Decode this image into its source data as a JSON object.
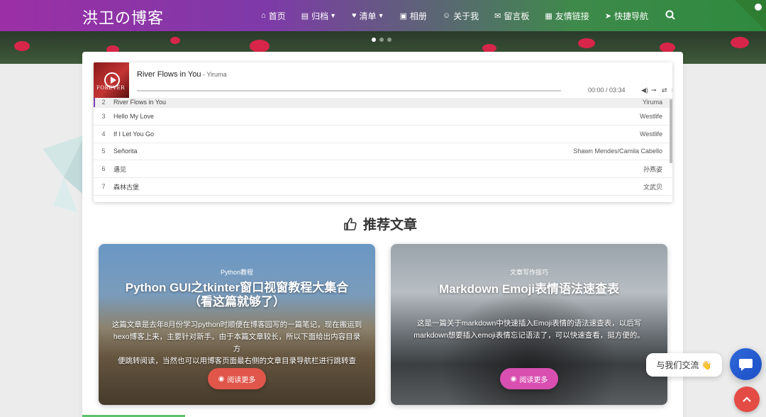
{
  "header": {
    "brand": "洪卫の博客",
    "nav": [
      {
        "label": "首页",
        "icon": "home-icon",
        "dropdown": false
      },
      {
        "label": "归档",
        "icon": "archive-icon",
        "dropdown": true
      },
      {
        "label": "清单",
        "icon": "heartbeat-icon",
        "dropdown": true
      },
      {
        "label": "相册",
        "icon": "image-icon",
        "dropdown": false
      },
      {
        "label": "关于我",
        "icon": "user-circle-icon",
        "dropdown": false
      },
      {
        "label": "留言板",
        "icon": "envelope-icon",
        "dropdown": false
      },
      {
        "label": "友情链接",
        "icon": "address-card-icon",
        "dropdown": false
      },
      {
        "label": "快捷导航",
        "icon": "paper-plane-icon",
        "dropdown": false
      }
    ],
    "search_icon": "search-icon"
  },
  "banner": {
    "slides": 3,
    "active_slide": 1
  },
  "player": {
    "current": {
      "title": "River Flows in You",
      "artist": " - Yiruma"
    },
    "time": "00:00 / 03:34",
    "controls": [
      "volume-icon",
      "order-icon",
      "loop-icon",
      "menu-icon"
    ],
    "playlist": [
      {
        "no": "2",
        "title": "River Flows in You",
        "artist": "Yiruma",
        "active": true
      },
      {
        "no": "3",
        "title": "Hello My Love",
        "artist": "Westlife"
      },
      {
        "no": "4",
        "title": "If I Let You Go",
        "artist": "Westlife"
      },
      {
        "no": "5",
        "title": "Señorita",
        "artist": "Shawn Mendes/Camila Cabello"
      },
      {
        "no": "6",
        "title": "遇见",
        "artist": "孙燕姿"
      },
      {
        "no": "7",
        "title": "森林古堡",
        "artist": "文武贝"
      }
    ]
  },
  "section": {
    "title": "推荐文章"
  },
  "articles": [
    {
      "category": "Python教程",
      "title_line1": "Python GUI之tkinter窗口视窗教程大集合",
      "title_line2": "（看这篇就够了）",
      "desc_lines": [
        "这篇文章是去年8月份学习python时顺便在博客园写的一篇笔记，现在搬运到",
        "hexo博客上来，主要针对新手。由于本篇文章较长，所以下面给出内容目录方",
        "便跳转阅读，当然也可以用博客页面最右侧的文章目录导航栏进行跳转查阅。"
      ],
      "button": "阅读更多",
      "button_color": "#e0564a"
    },
    {
      "category": "文章写作技巧",
      "title_line1": "Markdown Emoji表情语法速查表",
      "desc_lines": [
        "这是一篇关于markdown中快速插入Emoji表情的语法速查表，以后写",
        "markdown想要插入emoji表情忘记语法了，可以快速查看，挺方便的。"
      ],
      "button": "阅读更多",
      "button_color": "#d84fb0"
    }
  ],
  "chat": {
    "text": "与我们交流 👋"
  }
}
